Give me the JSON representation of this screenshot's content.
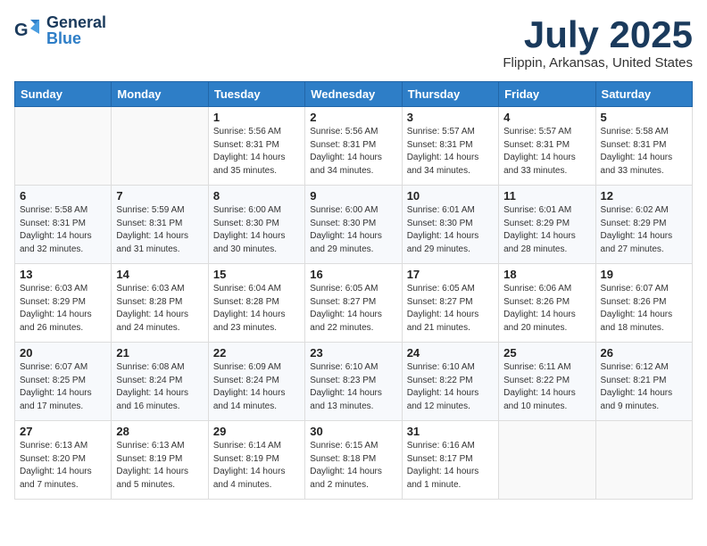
{
  "header": {
    "logo_general": "General",
    "logo_blue": "Blue",
    "main_title": "July 2025",
    "subtitle": "Flippin, Arkansas, United States"
  },
  "weekdays": [
    "Sunday",
    "Monday",
    "Tuesday",
    "Wednesday",
    "Thursday",
    "Friday",
    "Saturday"
  ],
  "weeks": [
    [
      {
        "day": "",
        "detail": ""
      },
      {
        "day": "",
        "detail": ""
      },
      {
        "day": "1",
        "detail": "Sunrise: 5:56 AM\nSunset: 8:31 PM\nDaylight: 14 hours\nand 35 minutes."
      },
      {
        "day": "2",
        "detail": "Sunrise: 5:56 AM\nSunset: 8:31 PM\nDaylight: 14 hours\nand 34 minutes."
      },
      {
        "day": "3",
        "detail": "Sunrise: 5:57 AM\nSunset: 8:31 PM\nDaylight: 14 hours\nand 34 minutes."
      },
      {
        "day": "4",
        "detail": "Sunrise: 5:57 AM\nSunset: 8:31 PM\nDaylight: 14 hours\nand 33 minutes."
      },
      {
        "day": "5",
        "detail": "Sunrise: 5:58 AM\nSunset: 8:31 PM\nDaylight: 14 hours\nand 33 minutes."
      }
    ],
    [
      {
        "day": "6",
        "detail": "Sunrise: 5:58 AM\nSunset: 8:31 PM\nDaylight: 14 hours\nand 32 minutes."
      },
      {
        "day": "7",
        "detail": "Sunrise: 5:59 AM\nSunset: 8:31 PM\nDaylight: 14 hours\nand 31 minutes."
      },
      {
        "day": "8",
        "detail": "Sunrise: 6:00 AM\nSunset: 8:30 PM\nDaylight: 14 hours\nand 30 minutes."
      },
      {
        "day": "9",
        "detail": "Sunrise: 6:00 AM\nSunset: 8:30 PM\nDaylight: 14 hours\nand 29 minutes."
      },
      {
        "day": "10",
        "detail": "Sunrise: 6:01 AM\nSunset: 8:30 PM\nDaylight: 14 hours\nand 29 minutes."
      },
      {
        "day": "11",
        "detail": "Sunrise: 6:01 AM\nSunset: 8:29 PM\nDaylight: 14 hours\nand 28 minutes."
      },
      {
        "day": "12",
        "detail": "Sunrise: 6:02 AM\nSunset: 8:29 PM\nDaylight: 14 hours\nand 27 minutes."
      }
    ],
    [
      {
        "day": "13",
        "detail": "Sunrise: 6:03 AM\nSunset: 8:29 PM\nDaylight: 14 hours\nand 26 minutes."
      },
      {
        "day": "14",
        "detail": "Sunrise: 6:03 AM\nSunset: 8:28 PM\nDaylight: 14 hours\nand 24 minutes."
      },
      {
        "day": "15",
        "detail": "Sunrise: 6:04 AM\nSunset: 8:28 PM\nDaylight: 14 hours\nand 23 minutes."
      },
      {
        "day": "16",
        "detail": "Sunrise: 6:05 AM\nSunset: 8:27 PM\nDaylight: 14 hours\nand 22 minutes."
      },
      {
        "day": "17",
        "detail": "Sunrise: 6:05 AM\nSunset: 8:27 PM\nDaylight: 14 hours\nand 21 minutes."
      },
      {
        "day": "18",
        "detail": "Sunrise: 6:06 AM\nSunset: 8:26 PM\nDaylight: 14 hours\nand 20 minutes."
      },
      {
        "day": "19",
        "detail": "Sunrise: 6:07 AM\nSunset: 8:26 PM\nDaylight: 14 hours\nand 18 minutes."
      }
    ],
    [
      {
        "day": "20",
        "detail": "Sunrise: 6:07 AM\nSunset: 8:25 PM\nDaylight: 14 hours\nand 17 minutes."
      },
      {
        "day": "21",
        "detail": "Sunrise: 6:08 AM\nSunset: 8:24 PM\nDaylight: 14 hours\nand 16 minutes."
      },
      {
        "day": "22",
        "detail": "Sunrise: 6:09 AM\nSunset: 8:24 PM\nDaylight: 14 hours\nand 14 minutes."
      },
      {
        "day": "23",
        "detail": "Sunrise: 6:10 AM\nSunset: 8:23 PM\nDaylight: 14 hours\nand 13 minutes."
      },
      {
        "day": "24",
        "detail": "Sunrise: 6:10 AM\nSunset: 8:22 PM\nDaylight: 14 hours\nand 12 minutes."
      },
      {
        "day": "25",
        "detail": "Sunrise: 6:11 AM\nSunset: 8:22 PM\nDaylight: 14 hours\nand 10 minutes."
      },
      {
        "day": "26",
        "detail": "Sunrise: 6:12 AM\nSunset: 8:21 PM\nDaylight: 14 hours\nand 9 minutes."
      }
    ],
    [
      {
        "day": "27",
        "detail": "Sunrise: 6:13 AM\nSunset: 8:20 PM\nDaylight: 14 hours\nand 7 minutes."
      },
      {
        "day": "28",
        "detail": "Sunrise: 6:13 AM\nSunset: 8:19 PM\nDaylight: 14 hours\nand 5 minutes."
      },
      {
        "day": "29",
        "detail": "Sunrise: 6:14 AM\nSunset: 8:19 PM\nDaylight: 14 hours\nand 4 minutes."
      },
      {
        "day": "30",
        "detail": "Sunrise: 6:15 AM\nSunset: 8:18 PM\nDaylight: 14 hours\nand 2 minutes."
      },
      {
        "day": "31",
        "detail": "Sunrise: 6:16 AM\nSunset: 8:17 PM\nDaylight: 14 hours\nand 1 minute."
      },
      {
        "day": "",
        "detail": ""
      },
      {
        "day": "",
        "detail": ""
      }
    ]
  ]
}
